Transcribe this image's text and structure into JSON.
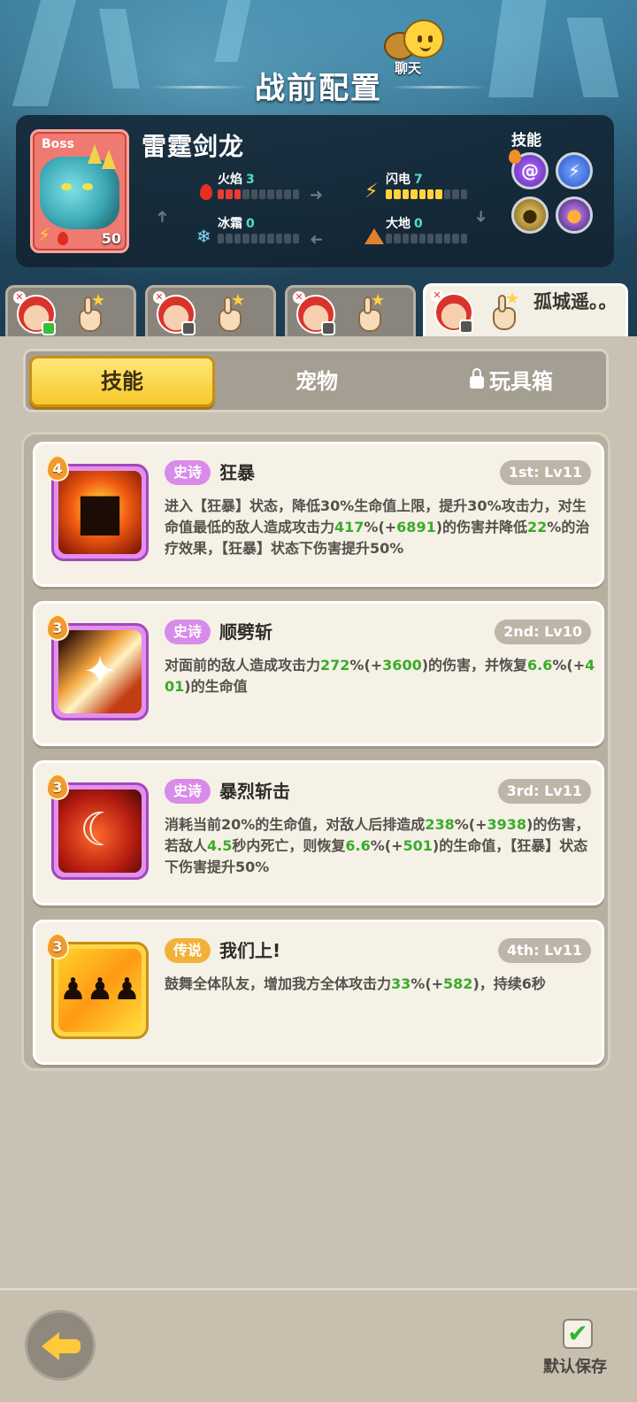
{
  "header": {
    "title": "战前配置",
    "chat_label": "聊天"
  },
  "boss": {
    "tag": "Boss",
    "name": "雷霆剑龙",
    "level": "50",
    "elements": [
      {
        "name": "火焰",
        "value": "3",
        "icon": "fire-icon",
        "filled": 3
      },
      {
        "name": "闪电",
        "value": "7",
        "icon": "lightning-icon",
        "filled": 7
      },
      {
        "name": "冰霜",
        "value": "0",
        "icon": "snowflake-icon",
        "filled": 0
      },
      {
        "name": "大地",
        "value": "0",
        "icon": "earth-icon",
        "filled": 0
      }
    ],
    "skills_label": "技能",
    "skill_icons": [
      "purple-swirl-icon",
      "blue-lightning-icon",
      "gold-beast-icon",
      "purple-creature-icon"
    ]
  },
  "heroes": [
    {
      "name": "",
      "status": "chat-icon"
    },
    {
      "name": "",
      "status": "controller-icon"
    },
    {
      "name": "",
      "status": "controller-icon"
    },
    {
      "name": "孤城遥。。",
      "status": "controller-icon"
    }
  ],
  "tabs": {
    "skills": "技能",
    "pets": "宠物",
    "toybox": "玩具箱"
  },
  "skills": [
    {
      "cost": "4",
      "rarity": "史诗",
      "name": "狂暴",
      "level": "1st: Lv11",
      "desc": [
        {
          "t": "进入【狂暴】状态，降低30%生命值上限，提升30%攻击力，对生命值最低的敌人造成攻击力"
        },
        {
          "t": "417",
          "h": true
        },
        {
          "t": "%(+"
        },
        {
          "t": "6891",
          "h": true
        },
        {
          "t": ")的伤害并降低"
        },
        {
          "t": "22",
          "h": true
        },
        {
          "t": "%的治疗效果，【狂暴】状态下伤害提升50%"
        }
      ]
    },
    {
      "cost": "3",
      "rarity": "史诗",
      "name": "顺劈斩",
      "level": "2nd: Lv10",
      "desc": [
        {
          "t": "对面前的敌人造成攻击力"
        },
        {
          "t": "272",
          "h": true
        },
        {
          "t": "%(+"
        },
        {
          "t": "3600",
          "h": true
        },
        {
          "t": ")的伤害，并恢复"
        },
        {
          "t": "6.6",
          "h": true
        },
        {
          "t": "%(+"
        },
        {
          "t": "401",
          "h": true
        },
        {
          "t": ")的生命值"
        }
      ]
    },
    {
      "cost": "3",
      "rarity": "史诗",
      "name": "暴烈斩击",
      "level": "3rd: Lv11",
      "desc": [
        {
          "t": "消耗当前20%的生命值，对敌人后排造成"
        },
        {
          "t": "238",
          "h": true
        },
        {
          "t": "%(+"
        },
        {
          "t": "3938",
          "h": true
        },
        {
          "t": ")的伤害，若敌人"
        },
        {
          "t": "4.5",
          "h": true
        },
        {
          "t": "秒内死亡，则恢复"
        },
        {
          "t": "6.6",
          "h": true
        },
        {
          "t": "%(+"
        },
        {
          "t": "501",
          "h": true
        },
        {
          "t": ")的生命值，【狂暴】状态下伤害提升50%"
        }
      ]
    },
    {
      "cost": "3",
      "rarity": "传说",
      "name": "我们上!",
      "level": "4th: Lv11",
      "desc": [
        {
          "t": "鼓舞全体队友，增加我方全体攻击力"
        },
        {
          "t": "33",
          "h": true
        },
        {
          "t": "%(+"
        },
        {
          "t": "582",
          "h": true
        },
        {
          "t": ")，持续6秒"
        }
      ]
    }
  ],
  "footer": {
    "save_label": "默认保存"
  }
}
